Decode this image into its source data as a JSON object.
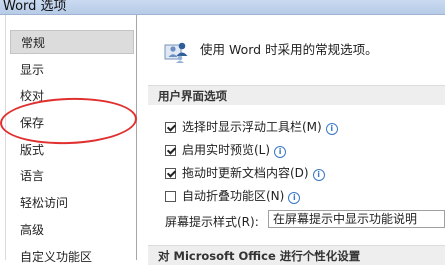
{
  "window": {
    "title": "Word 选项"
  },
  "sidebar": {
    "items": [
      {
        "label": "常规",
        "selected": true
      },
      {
        "label": "显示"
      },
      {
        "label": "校对"
      },
      {
        "label": "保存"
      },
      {
        "label": "版式"
      },
      {
        "label": "语言"
      },
      {
        "label": "轻松访问"
      },
      {
        "label": "高级"
      },
      {
        "label": "自定义功能区"
      }
    ]
  },
  "main": {
    "intro": {
      "icon": "options-people-icon",
      "text": "使用 Word 时采用的常规选项。"
    },
    "ui_section": {
      "title": "用户界面选项",
      "options": [
        {
          "label": "选择时显示浮动工具栏(M)",
          "checked": true,
          "has_info": true
        },
        {
          "label": "启用实时预览(L)",
          "checked": true,
          "has_info": true
        },
        {
          "label": "拖动时更新文档内容(D)",
          "checked": true,
          "has_info": true
        },
        {
          "label": "自动折叠功能区(N)",
          "checked": false,
          "has_info": true
        }
      ],
      "screentip": {
        "label": "屏幕提示样式(R):",
        "value": "在屏幕提示中显示功能说明"
      }
    },
    "personalize_section": {
      "title": "对 Microsoft Office 进行个性化设置"
    }
  },
  "colors": {
    "annotation": "#e03030",
    "info": "#3a77c6",
    "selected_bg": "#dcdcdc"
  }
}
